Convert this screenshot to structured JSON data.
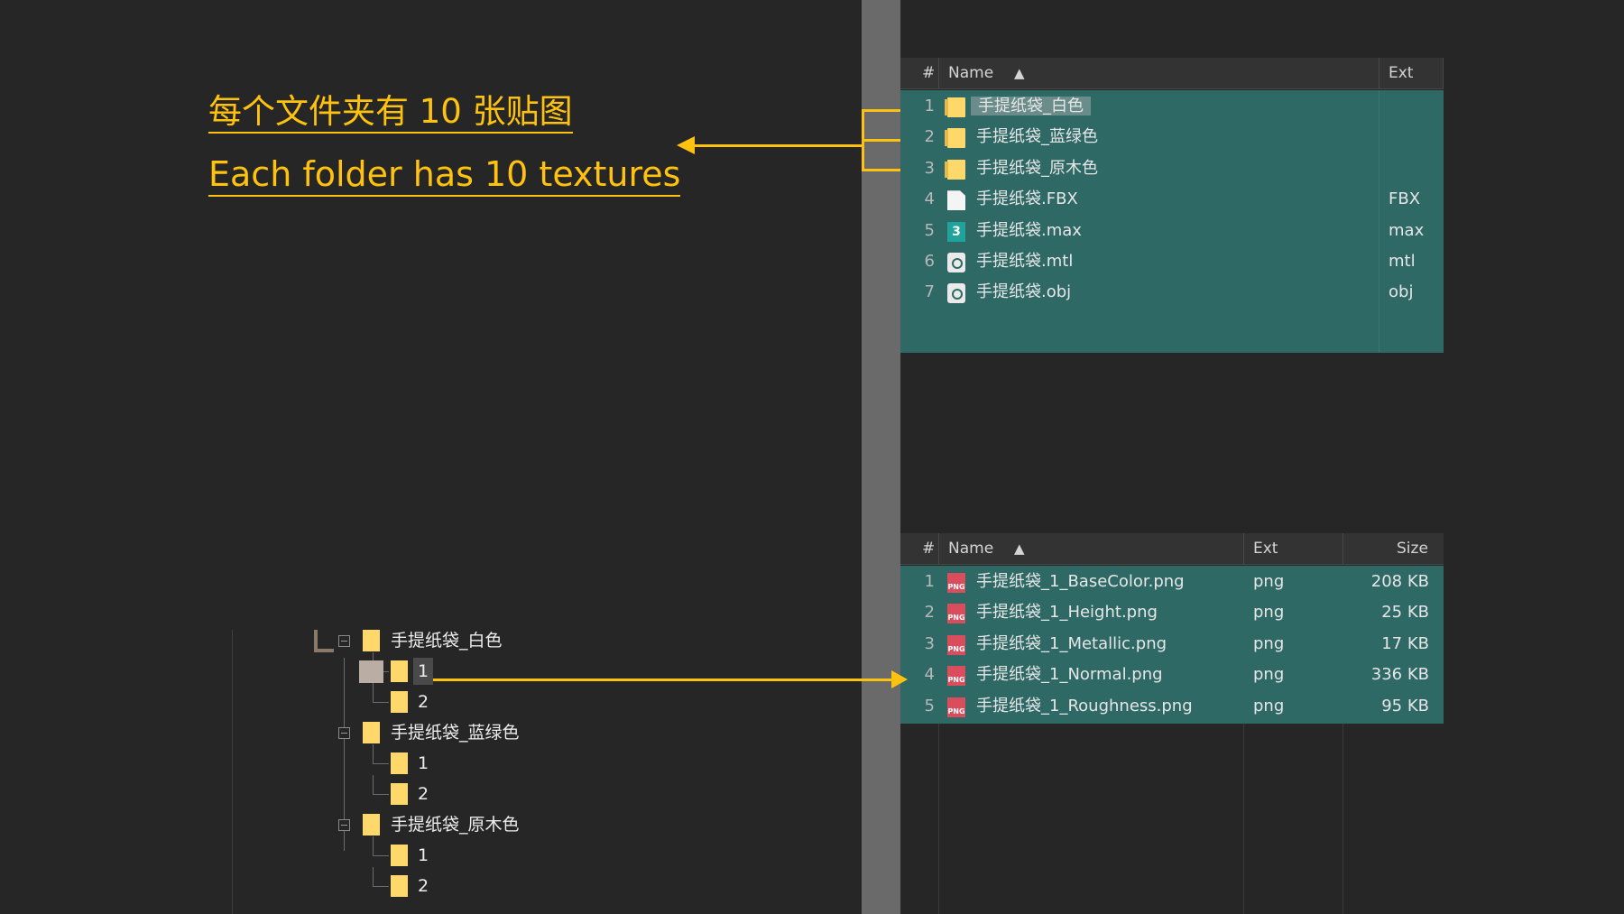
{
  "annotations": {
    "zh": "每个文件夹有 10 张贴图",
    "en": "Each folder has 10 textures"
  },
  "top_panel": {
    "columns": {
      "num": "#",
      "name": "Name",
      "ext": "Ext"
    },
    "rows": [
      {
        "num": "1",
        "name": "手提纸袋_白色",
        "ext": "",
        "icon": "folder-icon",
        "selected": true
      },
      {
        "num": "2",
        "name": "手提纸袋_蓝绿色",
        "ext": "",
        "icon": "folder-icon"
      },
      {
        "num": "3",
        "name": "手提纸袋_原木色",
        "ext": "",
        "icon": "folder-icon"
      },
      {
        "num": "4",
        "name": "手提纸袋.FBX",
        "ext": "FBX",
        "icon": "file-icon"
      },
      {
        "num": "5",
        "name": "手提纸袋.max",
        "ext": "max",
        "icon": "max-file-icon"
      },
      {
        "num": "6",
        "name": "手提纸袋.mtl",
        "ext": "mtl",
        "icon": "obj-file-icon"
      },
      {
        "num": "7",
        "name": "手提纸袋.obj",
        "ext": "obj",
        "icon": "obj-file-icon"
      }
    ]
  },
  "bottom_panel": {
    "columns": {
      "num": "#",
      "name": "Name",
      "ext": "Ext",
      "size": "Size"
    },
    "rows": [
      {
        "num": "1",
        "name": "手提纸袋_1_BaseColor.png",
        "ext": "png",
        "size": "208 KB",
        "icon": "png-file-icon"
      },
      {
        "num": "2",
        "name": "手提纸袋_1_Height.png",
        "ext": "png",
        "size": "25 KB",
        "icon": "png-file-icon"
      },
      {
        "num": "3",
        "name": "手提纸袋_1_Metallic.png",
        "ext": "png",
        "size": "17 KB",
        "icon": "png-file-icon"
      },
      {
        "num": "4",
        "name": "手提纸袋_1_Normal.png",
        "ext": "png",
        "size": "336 KB",
        "icon": "png-file-icon"
      },
      {
        "num": "5",
        "name": "手提纸袋_1_Roughness.png",
        "ext": "png",
        "size": "95 KB",
        "icon": "png-file-icon"
      }
    ],
    "png_badge": "PNG"
  },
  "tree": {
    "nodes": [
      {
        "label": "手提纸袋_白色",
        "children": [
          "1",
          "2"
        ]
      },
      {
        "label": "手提纸袋_蓝绿色",
        "children": [
          "1",
          "2"
        ]
      },
      {
        "label": "手提纸袋_原木色",
        "children": [
          "1",
          "2"
        ]
      }
    ]
  },
  "colors": {
    "background": "#262626",
    "accent": "#ffc20e",
    "selection": "#2e6966",
    "folder": "#ffd86b"
  }
}
